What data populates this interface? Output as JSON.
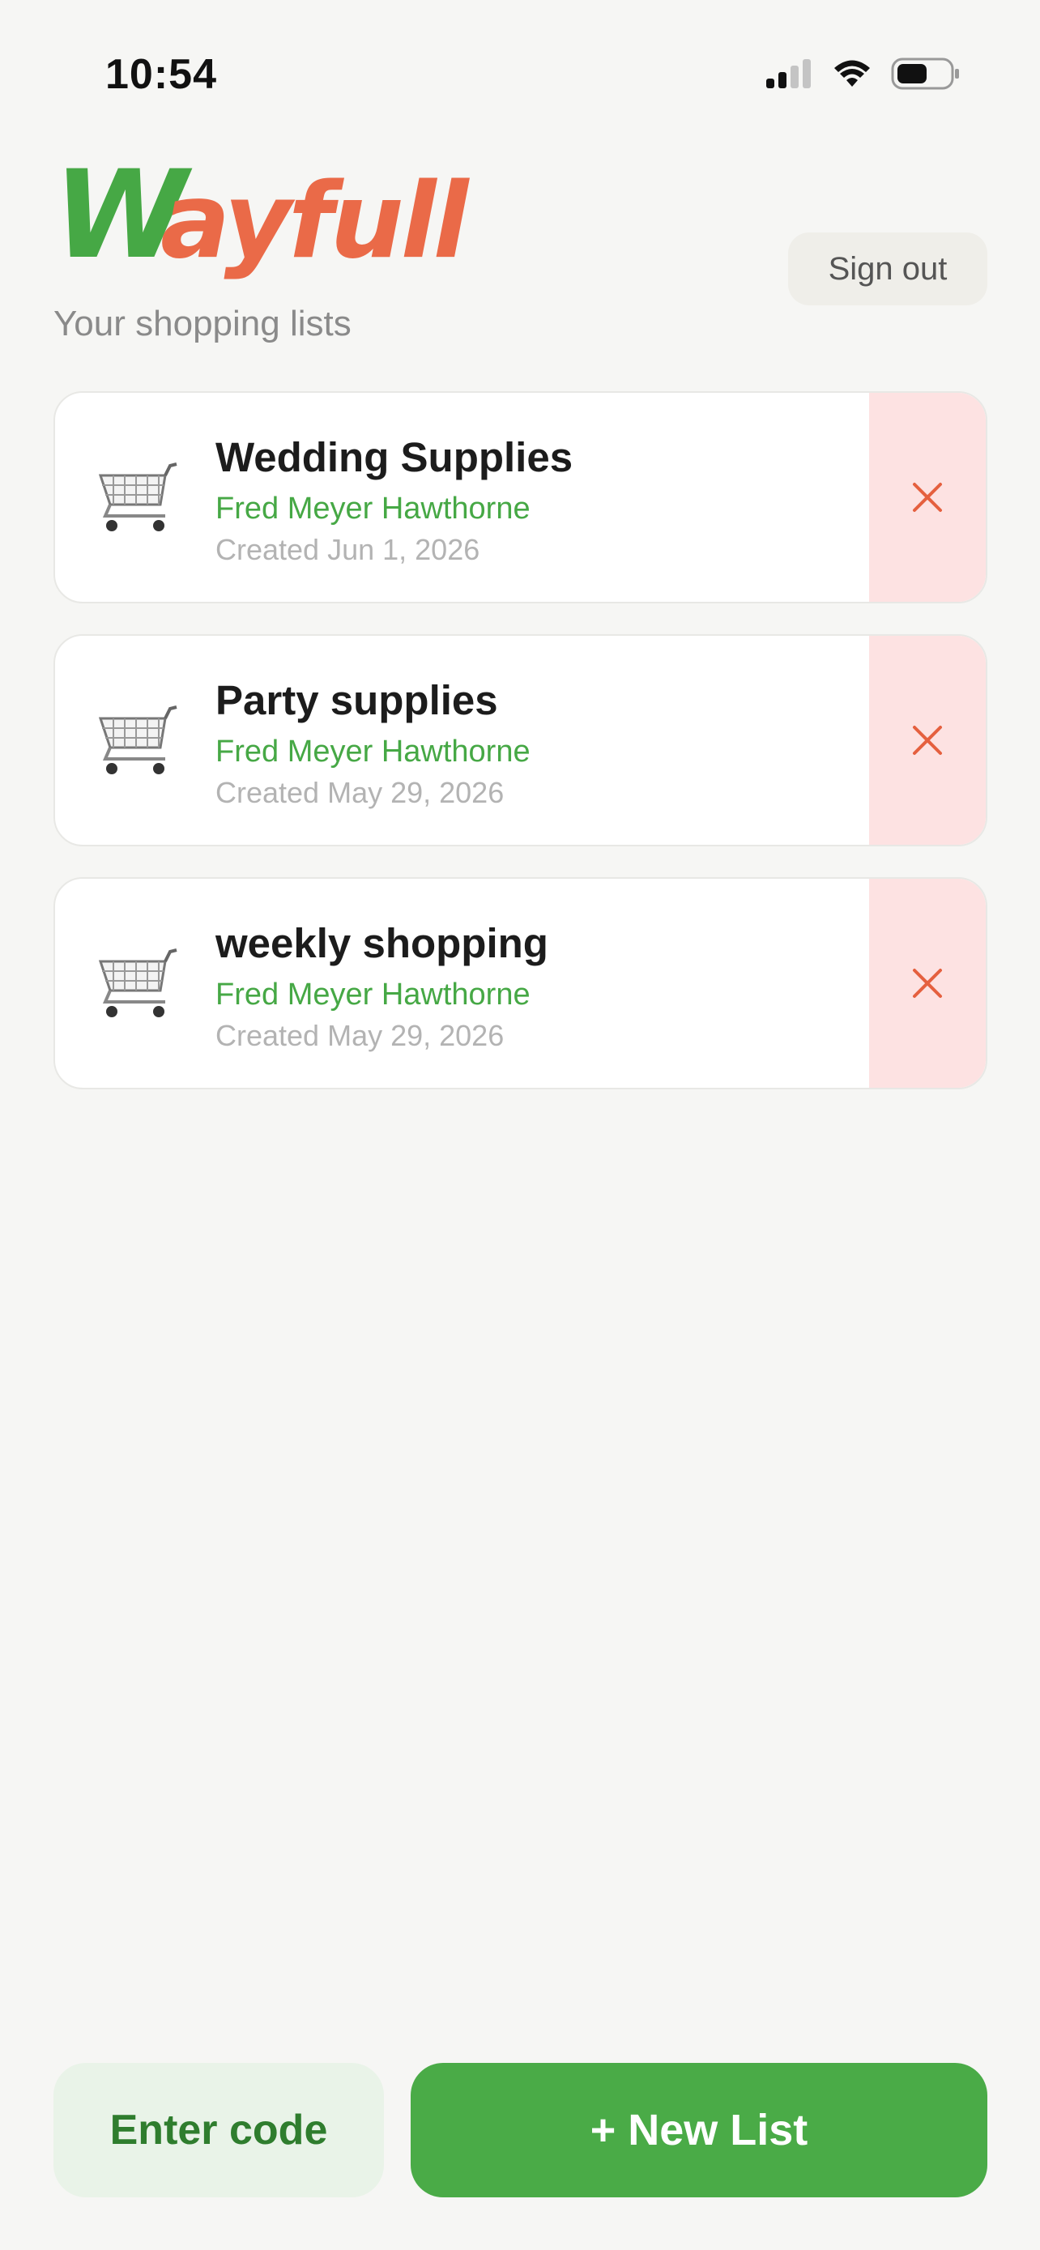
{
  "status_bar": {
    "time": "10:54"
  },
  "header": {
    "logo_text": "Wayfull",
    "subtitle": "Your shopping lists",
    "sign_out_label": "Sign out"
  },
  "lists": [
    {
      "title": "Wedding Supplies",
      "store": "Fred Meyer Hawthorne",
      "created": "Created Jun 1, 2026",
      "icon": "shopping-cart-icon"
    },
    {
      "title": "Party supplies",
      "store": "Fred Meyer Hawthorne",
      "created": "Created May 29, 2026",
      "icon": "shopping-cart-icon"
    },
    {
      "title": "weekly shopping",
      "store": "Fred Meyer Hawthorne",
      "created": "Created May 29, 2026",
      "icon": "shopping-cart-icon"
    }
  ],
  "footer": {
    "enter_code_label": "Enter code",
    "new_list_label": "+ New List"
  },
  "colors": {
    "brand_green": "#46a845",
    "brand_orange": "#ea6a48",
    "delete_bg": "#fde2e2",
    "delete_icon": "#e5603f"
  }
}
